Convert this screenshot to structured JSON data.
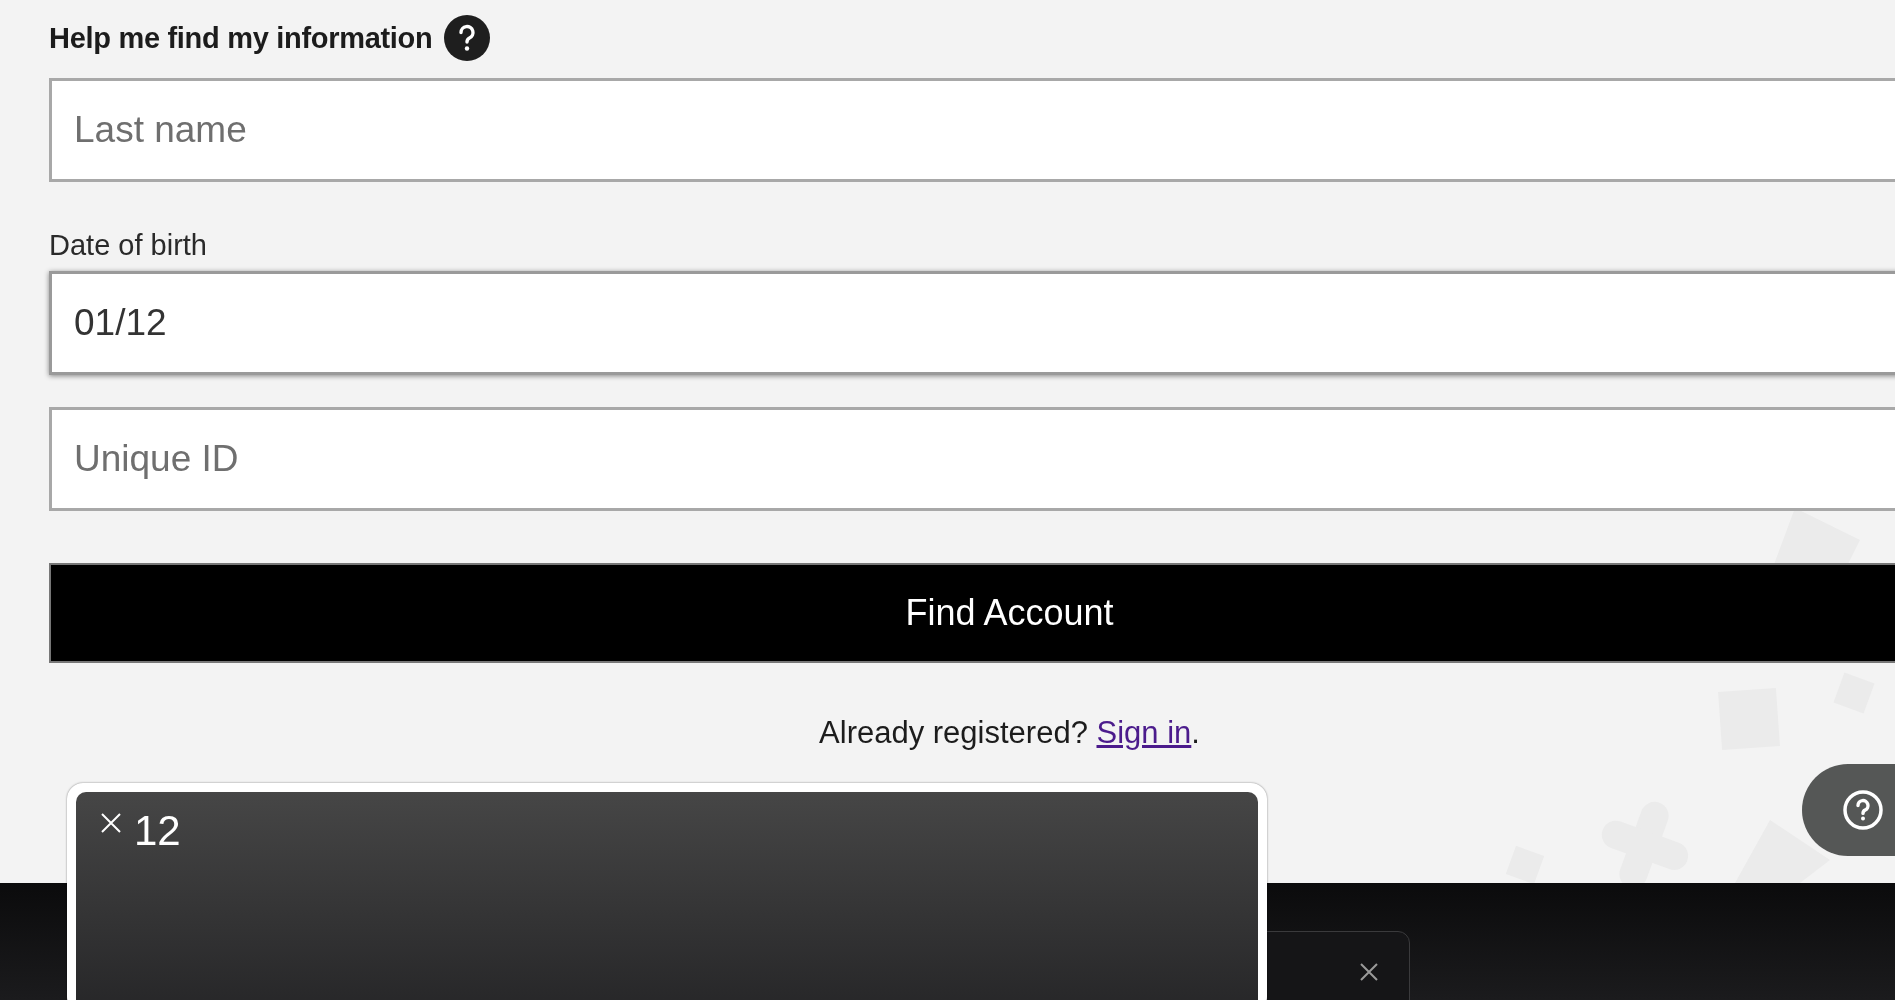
{
  "heading": {
    "text": "Help me find my information"
  },
  "fields": [
    {
      "kind": "text",
      "placeholder": "Last name",
      "focused": false
    },
    {
      "kind": "text",
      "label": "Date of birth",
      "value": "01/12",
      "focused": true
    },
    {
      "kind": "text",
      "placeholder": "Unique ID",
      "focused": false
    }
  ],
  "submit_button": {
    "label": "Find Account"
  },
  "signin": {
    "text": "Already registered?",
    "link": "Sign in",
    "trailing": "."
  },
  "suggestion_popup": {
    "text": "12"
  }
}
